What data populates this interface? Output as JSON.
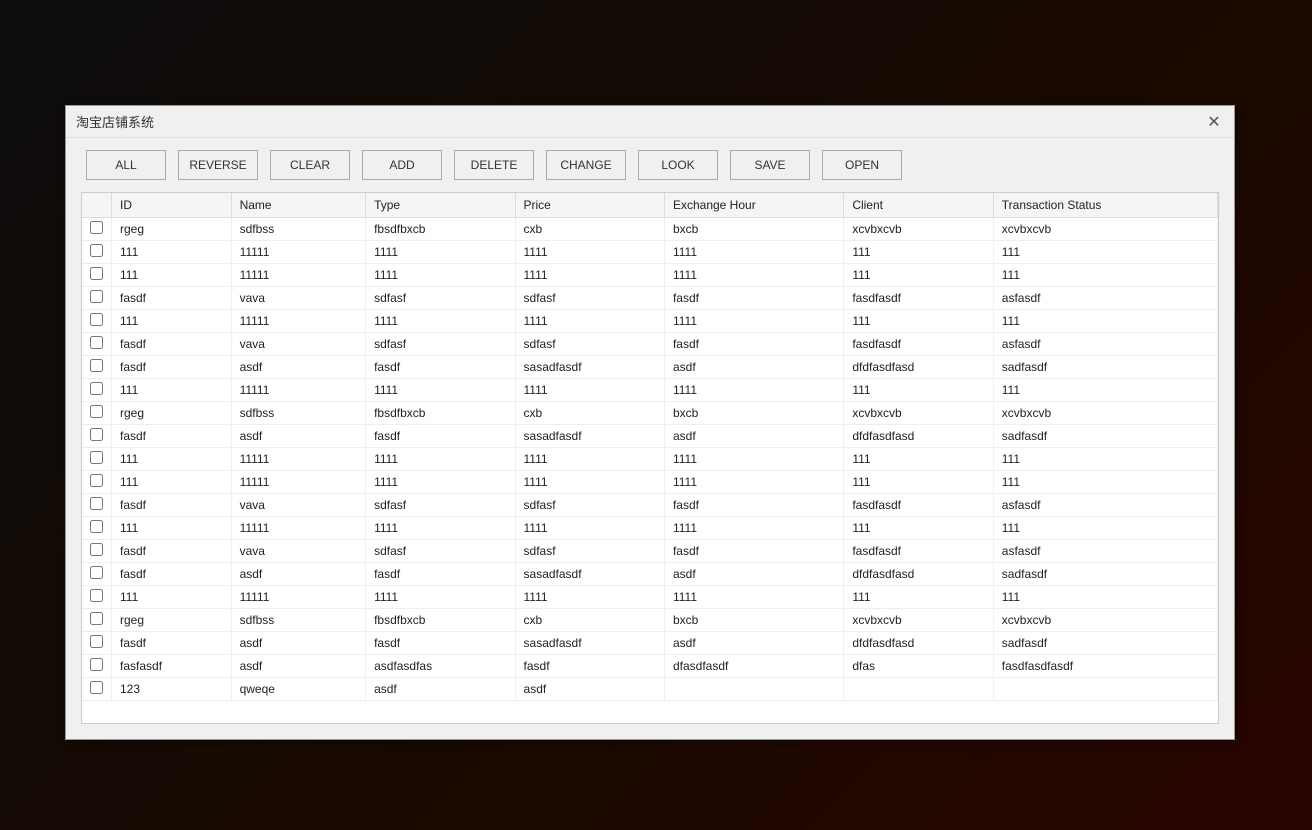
{
  "window": {
    "title": "淘宝店铺系统",
    "close_label": "✕"
  },
  "toolbar": {
    "buttons": [
      {
        "id": "all",
        "label": "ALL"
      },
      {
        "id": "reverse",
        "label": "REVERSE"
      },
      {
        "id": "clear",
        "label": "CLEAR"
      },
      {
        "id": "add",
        "label": "ADD"
      },
      {
        "id": "delete",
        "label": "DELETE"
      },
      {
        "id": "change",
        "label": "CHANGE"
      },
      {
        "id": "look",
        "label": "LOOK"
      },
      {
        "id": "save",
        "label": "SAVE"
      },
      {
        "id": "open",
        "label": "OPEN"
      }
    ]
  },
  "table": {
    "columns": [
      "ID",
      "Name",
      "Type",
      "Price",
      "Exchange Hour",
      "Client",
      "Transaction Status"
    ],
    "rows": [
      [
        "rgeg",
        "sdfbss",
        "fbsdfbxcb",
        "cxb",
        "bxcb",
        "xcvbxcvb",
        "xcvbxcvb"
      ],
      [
        "111",
        "11111",
        "1111",
        "1111",
        "1111",
        "111",
        "111"
      ],
      [
        "111",
        "11111",
        "1111",
        "1111",
        "1111",
        "111",
        "111"
      ],
      [
        "fasdf",
        "vava",
        "sdfasf",
        "sdfasf",
        "fasdf",
        "fasdfasdf",
        "asfasdf"
      ],
      [
        "111",
        "11111",
        "1111",
        "1111",
        "1111",
        "111",
        "111"
      ],
      [
        "fasdf",
        "vava",
        "sdfasf",
        "sdfasf",
        "fasdf",
        "fasdfasdf",
        "asfasdf"
      ],
      [
        "fasdf",
        "asdf",
        "fasdf",
        "sasadfasdf",
        "asdf",
        "dfdfasdfasd",
        "sadfasdf"
      ],
      [
        "111",
        "11111",
        "1111",
        "1111",
        "1111",
        "111",
        "111"
      ],
      [
        "rgeg",
        "sdfbss",
        "fbsdfbxcb",
        "cxb",
        "bxcb",
        "xcvbxcvb",
        "xcvbxcvb"
      ],
      [
        "fasdf",
        "asdf",
        "fasdf",
        "sasadfasdf",
        "asdf",
        "dfdfasdfasd",
        "sadfasdf"
      ],
      [
        "111",
        "11111",
        "1111",
        "1111",
        "1111",
        "111",
        "111"
      ],
      [
        "111",
        "11111",
        "1111",
        "1111",
        "1111",
        "111",
        "111"
      ],
      [
        "fasdf",
        "vava",
        "sdfasf",
        "sdfasf",
        "fasdf",
        "fasdfasdf",
        "asfasdf"
      ],
      [
        "111",
        "11111",
        "1111",
        "1111",
        "1111",
        "111",
        "111"
      ],
      [
        "fasdf",
        "vava",
        "sdfasf",
        "sdfasf",
        "fasdf",
        "fasdfasdf",
        "asfasdf"
      ],
      [
        "fasdf",
        "asdf",
        "fasdf",
        "sasadfasdf",
        "asdf",
        "dfdfasdfasd",
        "sadfasdf"
      ],
      [
        "111",
        "11111",
        "1111",
        "1111",
        "1111",
        "111",
        "111"
      ],
      [
        "rgeg",
        "sdfbss",
        "fbsdfbxcb",
        "cxb",
        "bxcb",
        "xcvbxcvb",
        "xcvbxcvb"
      ],
      [
        "fasdf",
        "asdf",
        "fasdf",
        "sasadfasdf",
        "asdf",
        "dfdfasdfasd",
        "sadfasdf"
      ],
      [
        "fasfasdf",
        "asdf",
        "asdfasdfas",
        "fasdf",
        "dfasdfasdf",
        "dfas",
        "fasdfasdfasdf"
      ],
      [
        "123",
        "qweqe",
        "asdf",
        "asdf",
        "",
        "",
        ""
      ]
    ]
  }
}
